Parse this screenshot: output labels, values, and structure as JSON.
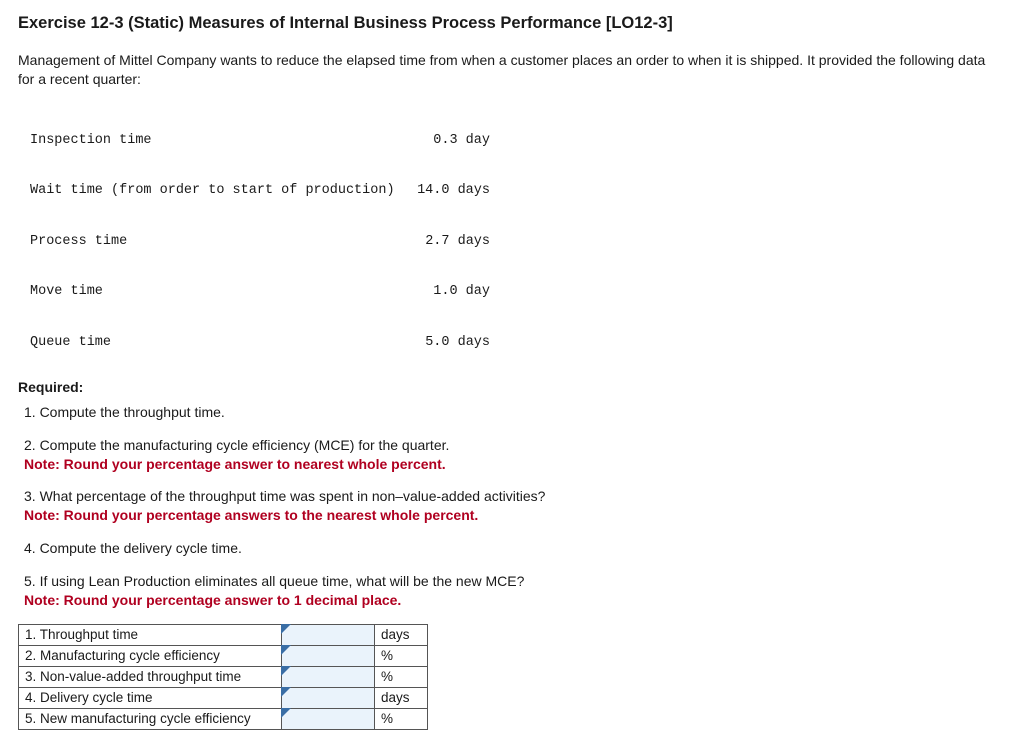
{
  "title": "Exercise 12-3 (Static) Measures of Internal Business Process Performance [LO12-3]",
  "intro": "Management of Mittel Company wants to reduce the elapsed time from when a customer places an order to when it is shipped. It provided the following data for a recent quarter:",
  "data_rows": [
    {
      "label": "Inspection time",
      "value": "0.3 day"
    },
    {
      "label": "Wait time (from order to start of production)",
      "value": "14.0 days"
    },
    {
      "label": "Process time",
      "value": "2.7 days"
    },
    {
      "label": "Move time",
      "value": "1.0 day"
    },
    {
      "label": "Queue time",
      "value": "5.0 days"
    }
  ],
  "required_label": "Required:",
  "questions": {
    "q1": "1. Compute the throughput time.",
    "q2": "2. Compute the manufacturing cycle efficiency (MCE) for the quarter.",
    "q2_note": "Note: Round your percentage answer to nearest whole percent.",
    "q3": "3. What percentage of the throughput time was spent in non–value-added activities?",
    "q3_note": "Note: Round your percentage answers to the nearest whole percent.",
    "q4": "4. Compute the delivery cycle time.",
    "q5": "5. If using Lean Production eliminates all queue time, what will be the new MCE?",
    "q5_note": "Note: Round your percentage answer to 1 decimal place."
  },
  "answers": [
    {
      "label": "1. Throughput time",
      "unit": "days"
    },
    {
      "label": "2. Manufacturing cycle efficiency",
      "unit": "%"
    },
    {
      "label": "3. Non-value-added throughput time",
      "unit": "%"
    },
    {
      "label": "4. Delivery cycle time",
      "unit": "days"
    },
    {
      "label": "5. New manufacturing cycle efficiency",
      "unit": "%"
    }
  ]
}
